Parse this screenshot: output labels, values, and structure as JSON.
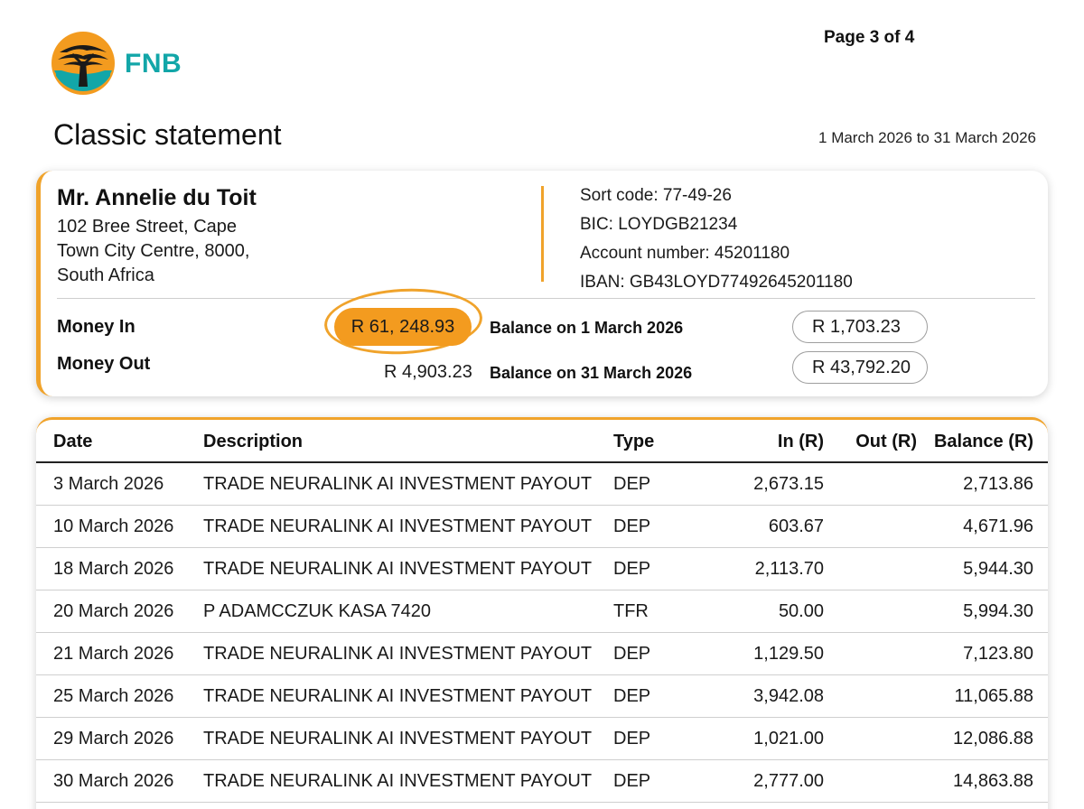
{
  "brand": {
    "name": "FNB",
    "colors": {
      "orange": "#f39b1f",
      "teal": "#12a6a8",
      "dark": "#1a1a1a"
    }
  },
  "page_number": "Page 3 of 4",
  "statement": {
    "title": "Classic statement",
    "period": "1 March 2026 to 31 March 2026"
  },
  "account_holder": {
    "name": "Mr. Annelie du Toit",
    "address_lines": [
      "102 Bree Street, Cape",
      "Town City Centre, 8000,",
      "South Africa"
    ]
  },
  "bank_details": {
    "sort_code": "Sort code: 77-49-26",
    "bic": "BIC: LOYDGB21234",
    "account_number": "Account number: 45201180",
    "iban": "IBAN: GB43LOYD77492645201180"
  },
  "summary": {
    "money_in_label": "Money In",
    "money_in_value": "R 61, 248.93",
    "money_out_label": "Money Out",
    "money_out_value": "R 4,903.23",
    "opening_balance_label": "Balance on 1 March 2026",
    "opening_balance_value": "R 1,703.23",
    "closing_balance_label": "Balance on 31 March 2026",
    "closing_balance_value": "R 43,792.20"
  },
  "transactions": {
    "columns": [
      "Date",
      "Description",
      "Type",
      "In (R)",
      "Out (R)",
      "Balance (R)"
    ],
    "rows": [
      [
        "3 March 2026",
        "TRADE NEURALINK AI INVESTMENT PAYOUT",
        "DEP",
        "2,673.15",
        "",
        "2,713.86"
      ],
      [
        "10 March 2026",
        "TRADE NEURALINK AI INVESTMENT PAYOUT",
        "DEP",
        "603.67",
        "",
        "4,671.96"
      ],
      [
        "18 March 2026",
        "TRADE NEURALINK AI INVESTMENT PAYOUT",
        "DEP",
        "2,113.70",
        "",
        "5,944.30"
      ],
      [
        "20 March 2026",
        "P ADAMCCZUK KASA 7420",
        "TFR",
        "50.00",
        "",
        "5,994.30"
      ],
      [
        "21 March 2026",
        "TRADE NEURALINK AI INVESTMENT PAYOUT",
        "DEP",
        "1,129.50",
        "",
        "7,123.80"
      ],
      [
        "25 March 2026",
        "TRADE NEURALINK AI INVESTMENT PAYOUT",
        "DEP",
        "3,942.08",
        "",
        "11,065.88"
      ],
      [
        "29 March 2026",
        "TRADE NEURALINK AI INVESTMENT PAYOUT",
        "DEP",
        "1,021.00",
        "",
        "12,086.88"
      ],
      [
        "30 March 2026",
        "TRADE NEURALINK AI INVESTMENT PAYOUT",
        "DEP",
        "2,777.00",
        "",
        "14,863.88"
      ]
    ]
  }
}
